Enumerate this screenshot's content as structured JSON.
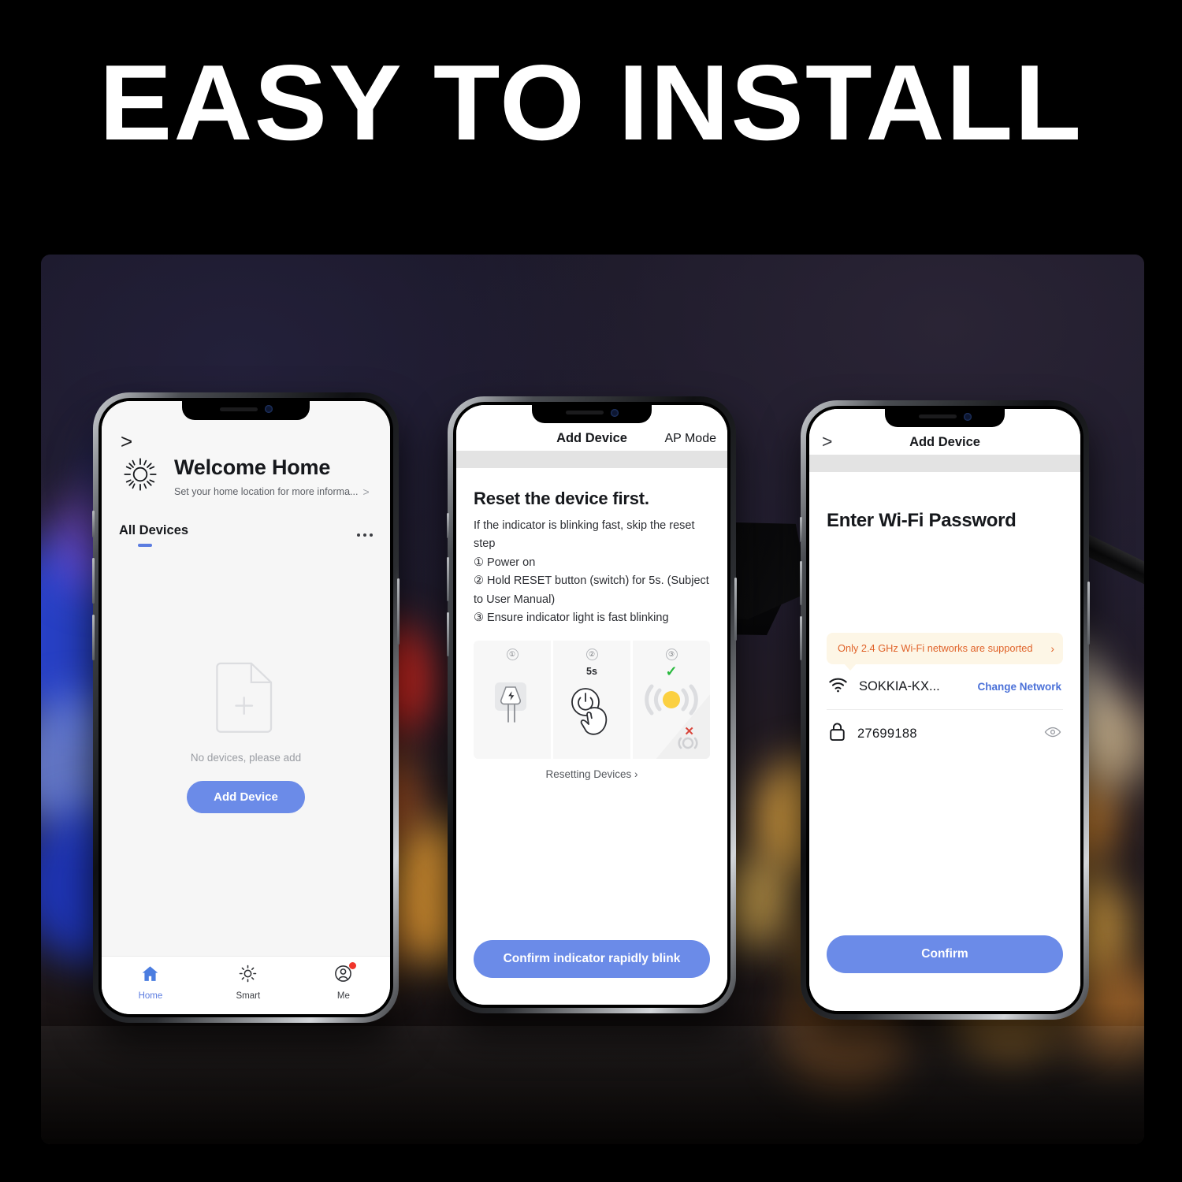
{
  "headline": "EASY TO INSTALL",
  "phone1": {
    "back_chevron": ">",
    "home_title": "Welcome Home",
    "home_subtitle": "Set your home location for more informa...",
    "subtitle_chevron": ">",
    "tab_label": "All Devices",
    "more_icon": "ellipsis-icon",
    "empty_text": "No devices, please add",
    "add_button": "Add Device",
    "nav": [
      {
        "label": "Home",
        "icon": "home-icon",
        "active": true
      },
      {
        "label": "Smart",
        "icon": "sun-icon",
        "active": false
      },
      {
        "label": "Me",
        "icon": "user-circle-icon",
        "active": false,
        "badge": true
      }
    ]
  },
  "phone2": {
    "nav_title": "Add Device",
    "nav_right": "AP Mode",
    "heading": "Reset the device first.",
    "body": "If the indicator is blinking fast, skip the reset step",
    "steps": [
      "① Power on",
      "② Hold RESET button (switch) for 5s. (Subject to User Manual)",
      "③ Ensure indicator light is fast blinking"
    ],
    "illus": {
      "step1_num": "①",
      "step2_num": "②",
      "step3_num": "③",
      "hold_time": "5s",
      "check_mark": "✓",
      "cross_mark": "✕"
    },
    "resetting_link": "Resetting Devices ›",
    "cta": "Confirm indicator rapidly blink"
  },
  "phone3": {
    "back_chevron": ">",
    "nav_title": "Add Device",
    "heading": "Enter Wi-Fi Password",
    "tip": "Only 2.4 GHz Wi-Fi networks are supported",
    "tip_chevron": "›",
    "ssid": "SOKKIA-KX...",
    "change_network": "Change Network",
    "password": "27699188",
    "wifi_icon": "wifi-icon",
    "lock_icon": "lock-icon",
    "eye_icon": "eye-icon",
    "cta": "Confirm"
  },
  "device": {
    "name": "smart-switch",
    "touch_button_icon": "power-icon",
    "leds": [
      "blue",
      "green",
      "blue"
    ]
  },
  "colors": {
    "accent_blue": "#6b8be8",
    "link_blue": "#4b71d8",
    "warning_orange": "#e0632a",
    "success_green": "#27b93c",
    "error_red": "#d9453b",
    "badge_red": "#f0352b",
    "led_blue": "#1d46f5",
    "led_green": "#19d222",
    "page_background": "#000000",
    "screen_background": "#ffffff"
  }
}
